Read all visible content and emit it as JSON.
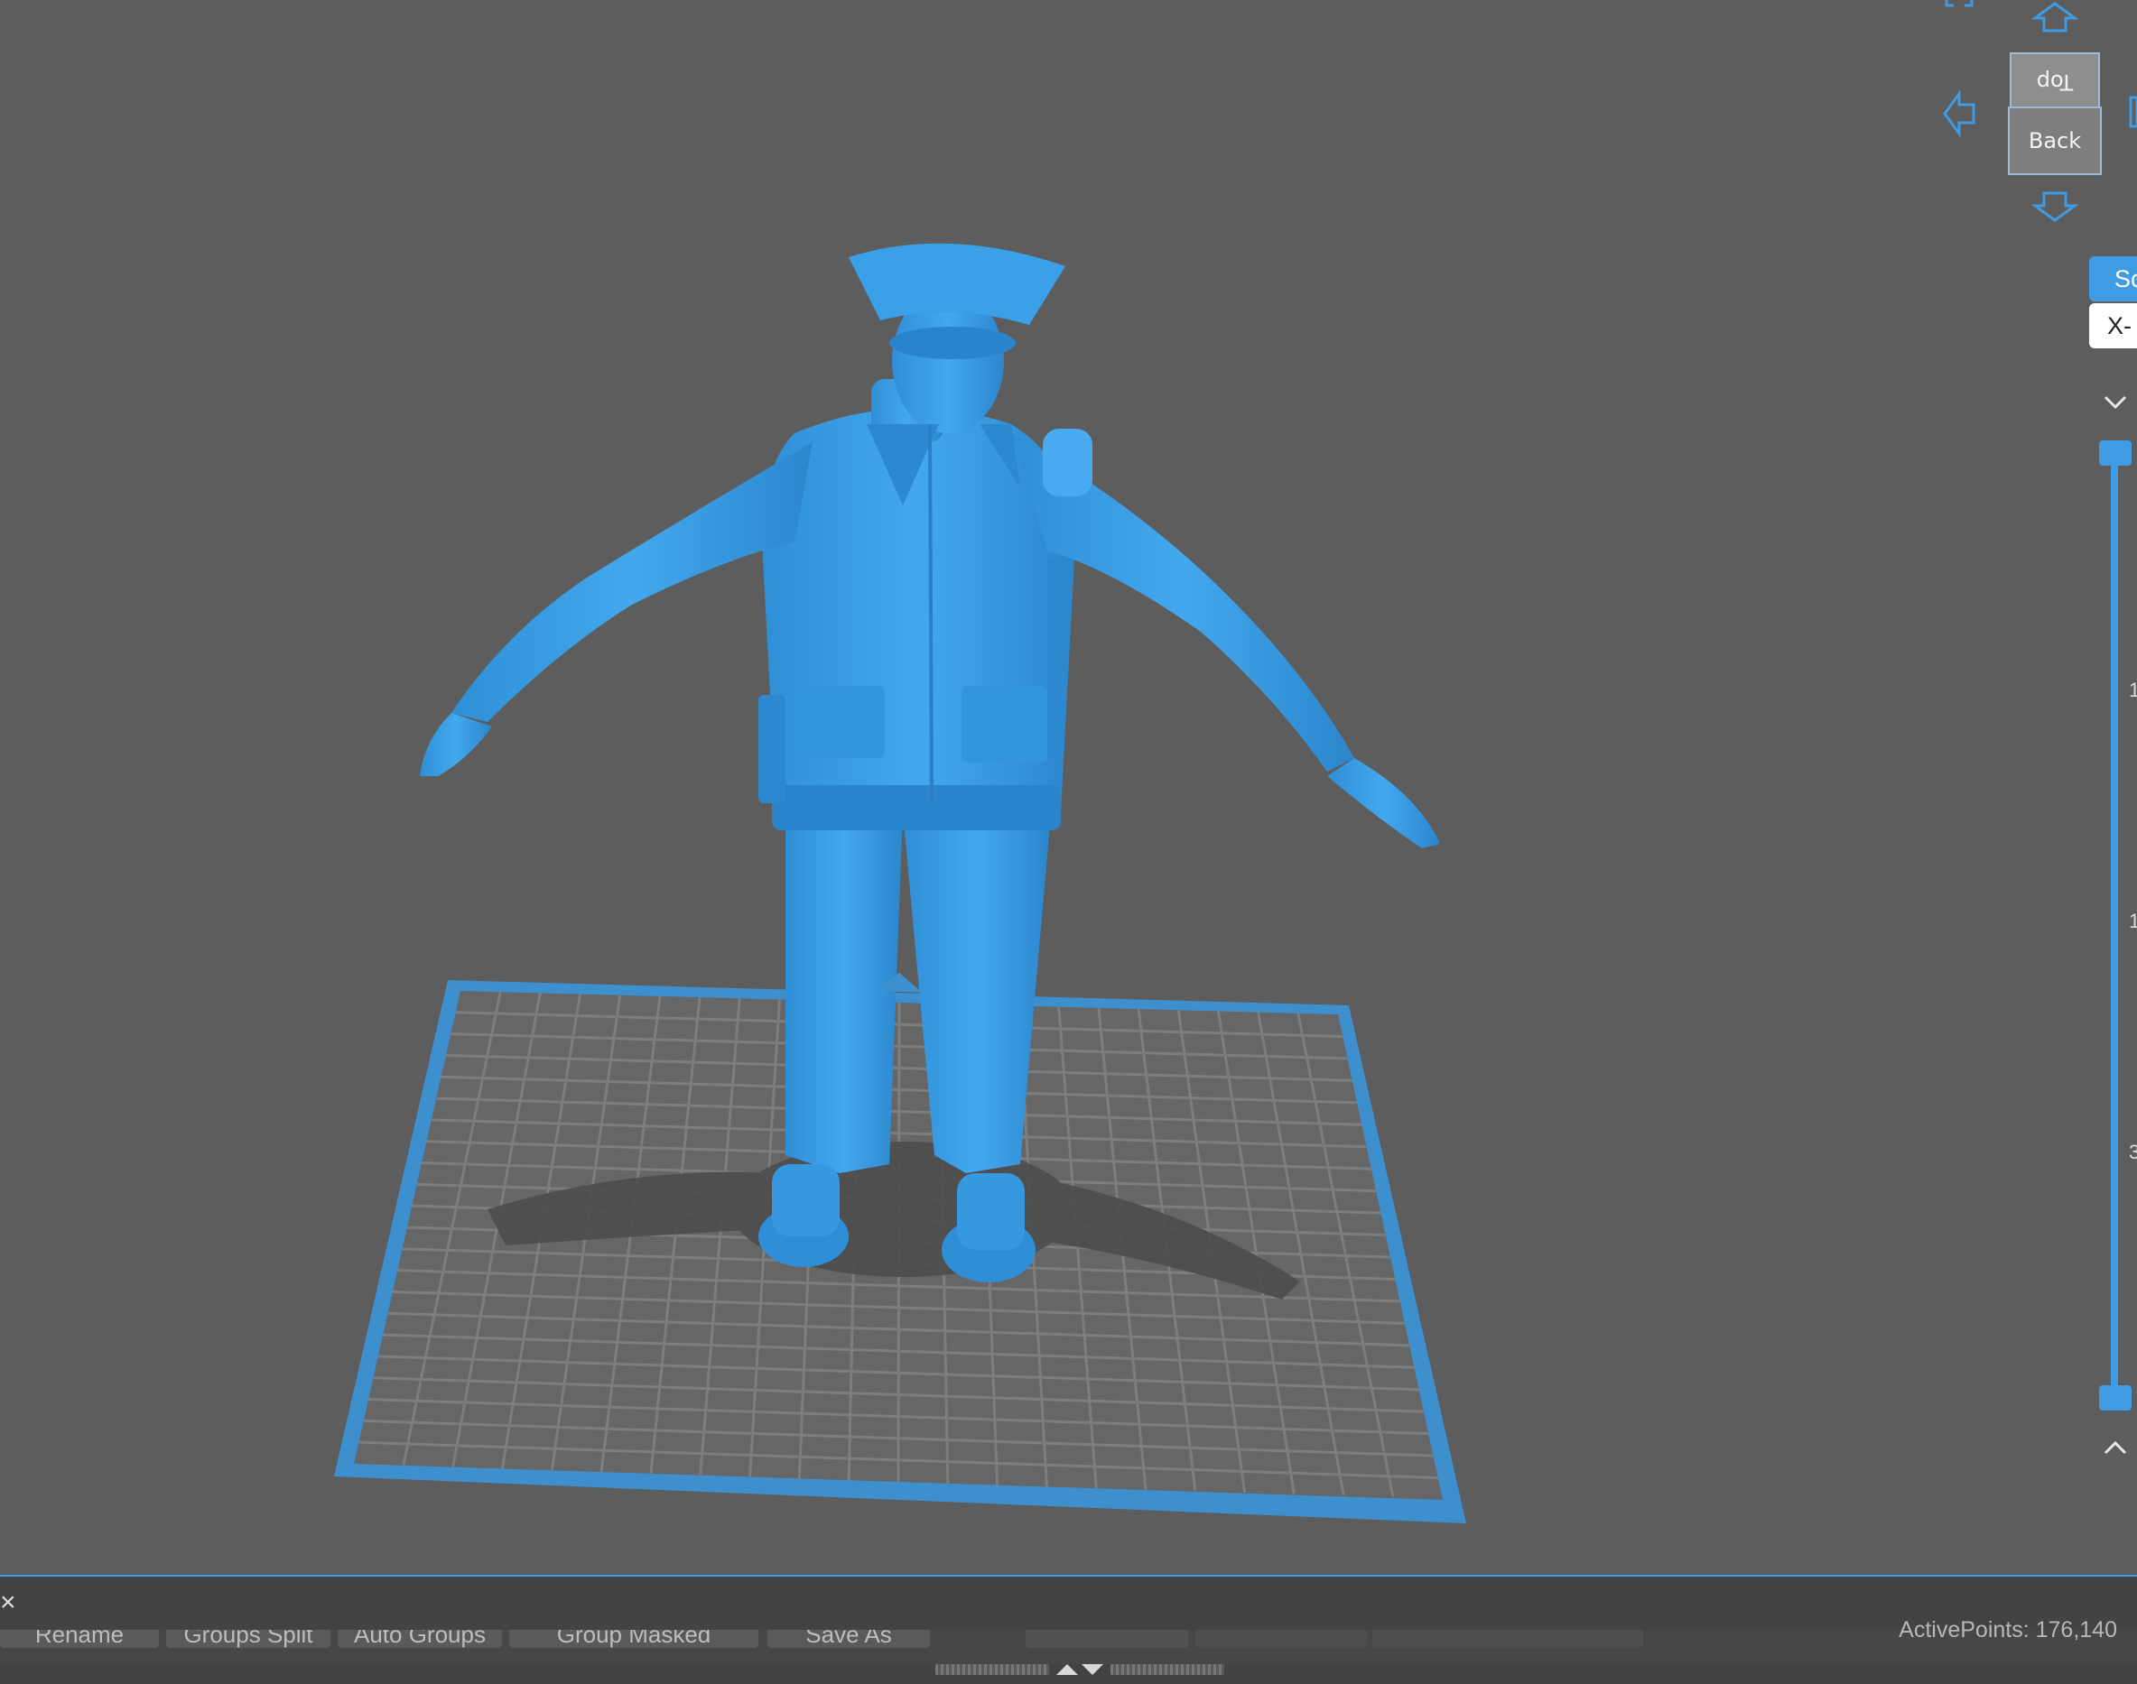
{
  "nav_cube": {
    "top_label": "Top",
    "back_label": "Back"
  },
  "side_panel": {
    "tab_active_label": "Sc",
    "tab_axis_label": "X-",
    "slider_ticks": [
      "1",
      "1",
      "3"
    ]
  },
  "bottom_toolbar": {
    "buttons": [
      "Rename",
      "Groups Split",
      "Auto Groups",
      "Group Masked",
      "Save As"
    ],
    "status": "ActivePoints: 176,140"
  },
  "colors": {
    "model": "#3ba0e6",
    "accent": "#3e9be4",
    "viewport_bg": "#5d5d5d",
    "plate_grid": "#7a7a7a"
  }
}
